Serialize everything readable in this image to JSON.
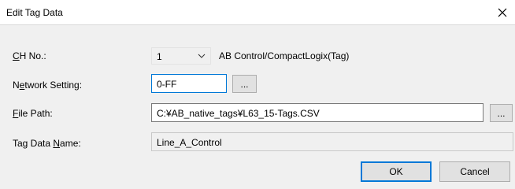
{
  "dialog": {
    "title": "Edit Tag Data",
    "close_icon": "close-icon"
  },
  "fields": {
    "ch_no": {
      "label_underlined": "C",
      "label_rest": "H No.:",
      "value": "1",
      "protocol": "AB Control/CompactLogix(Tag)"
    },
    "network": {
      "label_pre": "N",
      "label_underlined": "e",
      "label_rest": "twork Setting:",
      "value": "0-FF",
      "browse_label": "..."
    },
    "file_path": {
      "label_underlined": "F",
      "label_rest": "ile Path:",
      "value": "C:¥AB_native_tags¥L63_15-Tags.CSV",
      "browse_label": "..."
    },
    "tag_data_name": {
      "label_pre": "Tag Data ",
      "label_underlined": "N",
      "label_rest": "ame:",
      "value": "Line_A_Control"
    }
  },
  "buttons": {
    "ok": "OK",
    "cancel": "Cancel"
  },
  "colors": {
    "focus_border": "#0078d7",
    "dialog_bg": "#f0f0f0"
  }
}
